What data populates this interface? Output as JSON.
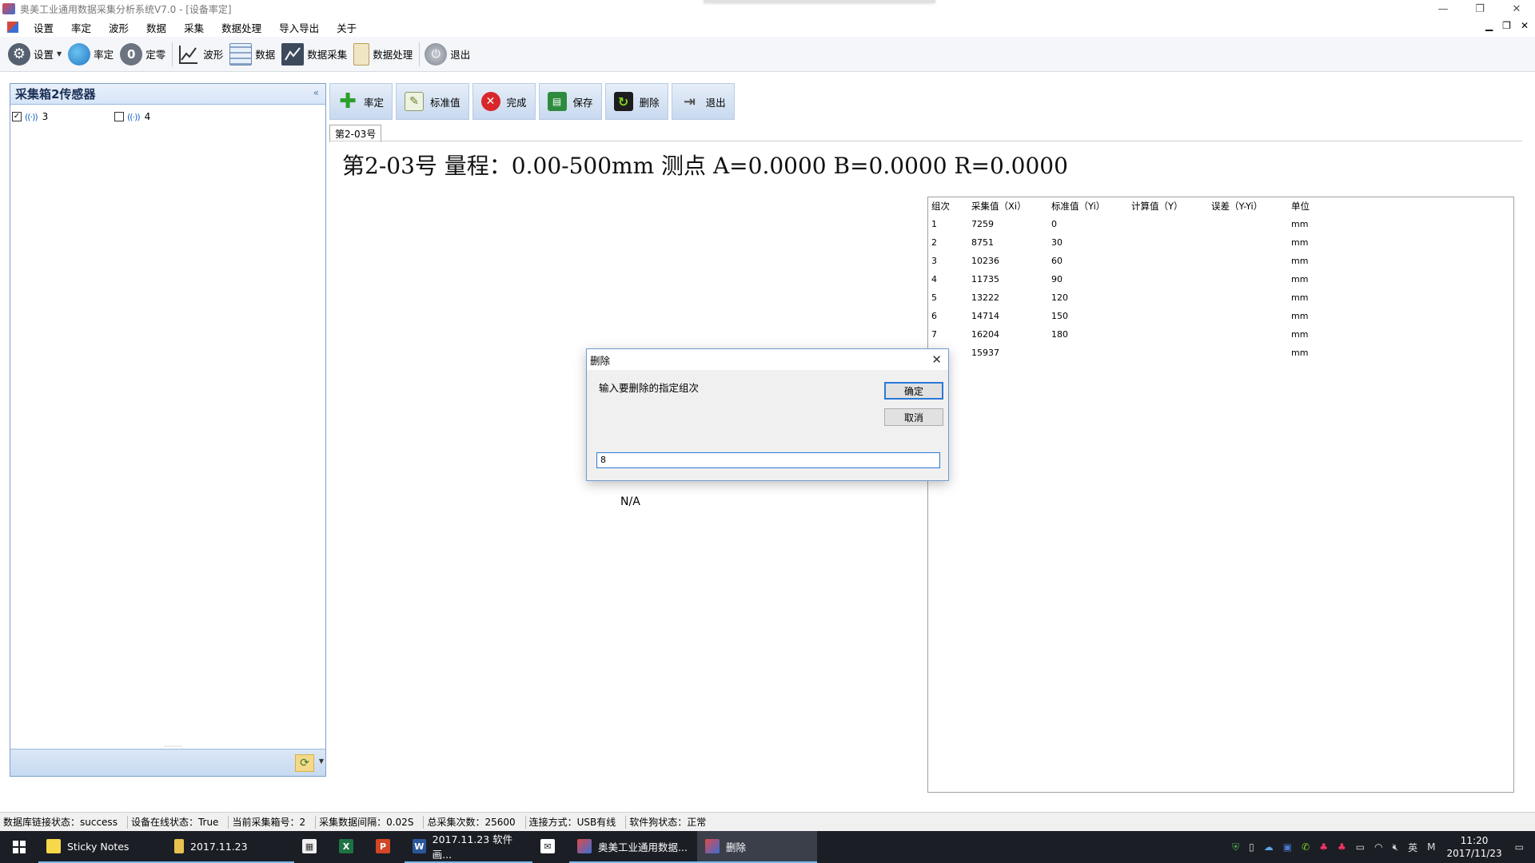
{
  "window": {
    "title": "奥美工业通用数据采集分析系统V7.0 - [设备率定]",
    "controls": [
      "—",
      "❐",
      "✕"
    ]
  },
  "menu": {
    "items": [
      "设置",
      "率定",
      "波形",
      "数据",
      "采集",
      "数据处理",
      "导入导出",
      "关于"
    ]
  },
  "toolbar": {
    "settings": "设置",
    "calibrate": "率定",
    "zero": "定零",
    "wave": "波形",
    "data": "数据",
    "acquire": "数据采集",
    "process": "数据处理",
    "exit": "退出"
  },
  "left_panel": {
    "title": "采集箱2传感器",
    "collapse": "«",
    "sensors": [
      {
        "label": "3",
        "checked": true
      },
      {
        "label": "4",
        "checked": false
      }
    ]
  },
  "actions": {
    "calibrate": "率定",
    "standard": "标准值",
    "finish": "完成",
    "save": "保存",
    "delete": "删除",
    "exit": "退出"
  },
  "tab": {
    "label": "第2-03号"
  },
  "heading": "第2-03号  量程：0.00-500mm  测点 A=0.0000  B=0.0000  R=0.0000",
  "table": {
    "headers": [
      "组次",
      "采集值（Xi）",
      "标准值（Yi）",
      "计算值（Y）",
      "误差（Y-Yi）",
      "单位"
    ],
    "rows": [
      [
        "1",
        "7259",
        "0",
        "",
        "",
        "mm"
      ],
      [
        "2",
        "8751",
        "30",
        "",
        "",
        "mm"
      ],
      [
        "3",
        "10236",
        "60",
        "",
        "",
        "mm"
      ],
      [
        "4",
        "11735",
        "90",
        "",
        "",
        "mm"
      ],
      [
        "5",
        "13222",
        "120",
        "",
        "",
        "mm"
      ],
      [
        "6",
        "14714",
        "150",
        "",
        "",
        "mm"
      ],
      [
        "7",
        "16204",
        "180",
        "",
        "",
        "mm"
      ],
      [
        "",
        "15937",
        "",
        "",
        "",
        "mm"
      ]
    ]
  },
  "na_text": "N/A",
  "dialog": {
    "title": "删除",
    "prompt": "输入要删除的指定组次",
    "ok": "确定",
    "cancel": "取消",
    "input_value": "8"
  },
  "status": {
    "db": "数据库链接状态：success",
    "online": "设备在线状态：True",
    "box": "当前采集箱号：2",
    "interval": "采集数据间隔：0.02S",
    "total": "总采集次数：25600",
    "conn": "连接方式：USB有线",
    "dongle": "软件狗状态：正常"
  },
  "taskbar": {
    "apps": [
      {
        "label": "Sticky Notes"
      },
      {
        "label": "2017.11.23"
      },
      {
        "label": "2017.11.23 软件画..."
      },
      {
        "label": "奥美工业通用数据..."
      },
      {
        "label": "删除"
      }
    ],
    "ime": "英",
    "time": "11:20",
    "date": "2017/11/23"
  },
  "colors": {
    "accent": "#2b79d8",
    "panel_header": "#d6e5f7",
    "taskbar": "#1b1e25"
  }
}
